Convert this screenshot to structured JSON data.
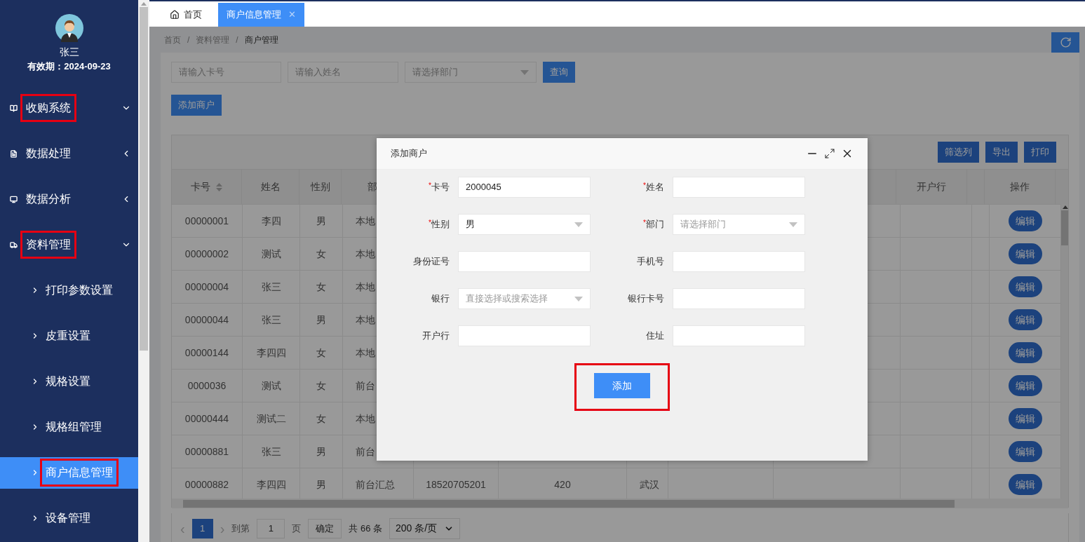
{
  "sidebar": {
    "user": {
      "name": "张三",
      "validity": "有效期：2024-09-23"
    },
    "items": [
      {
        "label": "收购系统",
        "expanded": true,
        "highlighted": true
      },
      {
        "label": "数据处理",
        "expanded": false,
        "highlighted": false
      },
      {
        "label": "数据分析",
        "expanded": false,
        "highlighted": false
      },
      {
        "label": "资料管理",
        "expanded": true,
        "highlighted": true,
        "children": [
          {
            "label": "打印参数设置",
            "selected": false,
            "highlighted": false
          },
          {
            "label": "皮重设置",
            "selected": false,
            "highlighted": false
          },
          {
            "label": "规格设置",
            "selected": false,
            "highlighted": false
          },
          {
            "label": "规格组管理",
            "selected": false,
            "highlighted": false
          },
          {
            "label": "商户信息管理",
            "selected": true,
            "highlighted": true
          },
          {
            "label": "设备管理",
            "selected": false,
            "highlighted": false
          }
        ]
      }
    ]
  },
  "tabs": [
    {
      "label": "首页",
      "selected": false,
      "closable": false
    },
    {
      "label": "商户信息管理",
      "selected": true,
      "closable": true,
      "close": "✕"
    }
  ],
  "breadcrumb": [
    "首页",
    "资料管理",
    "商户管理"
  ],
  "breadcrumb_separator": "/",
  "search": {
    "card_placeholder": "请输入卡号",
    "name_placeholder": "请输入姓名",
    "department_placeholder": "请选择部门",
    "button": "查询"
  },
  "add_button": "添加商户",
  "table": {
    "toolbar": [
      "筛选列",
      "导出",
      "打印"
    ],
    "columns_left": [
      "卡号",
      "姓名",
      "性别",
      "部"
    ],
    "columns_right": [
      "开户行",
      "操作"
    ],
    "rows": [
      {
        "cells": [
          "00000001",
          "李四",
          "男",
          "本地"
        ],
        "action": "编辑"
      },
      {
        "cells": [
          "00000002",
          "测试",
          "女",
          "本地"
        ],
        "action": "编辑"
      },
      {
        "cells": [
          "00000004",
          "张三",
          "女",
          "本地"
        ],
        "action": "编辑"
      },
      {
        "cells": [
          "00000044",
          "张三",
          "男",
          "本地"
        ],
        "action": "编辑"
      },
      {
        "cells": [
          "00000144",
          "李四四",
          "女",
          "本地"
        ],
        "action": "编辑"
      },
      {
        "cells": [
          "0000036",
          "测试",
          "女",
          "前台"
        ],
        "action": "编辑"
      },
      {
        "cells": [
          "00000444",
          "测试二",
          "女",
          "本地"
        ],
        "action": "编辑"
      },
      {
        "cells": [
          "00000881",
          "张三",
          "男",
          "前台"
        ],
        "action": "编辑"
      },
      {
        "cells": [
          "00000882",
          "李四四",
          "男",
          "前台汇总",
          "18520705201",
          "420",
          "武汉"
        ],
        "action": "编辑"
      }
    ]
  },
  "pagination": {
    "prev": "‹",
    "pages": [
      {
        "label": "1",
        "selected": true
      }
    ],
    "next": "›",
    "goto_label": "到第",
    "goto_value": "1",
    "page_unit": "页",
    "confirm": "确定",
    "total": "共 66 条",
    "page_size": "200 条/页"
  },
  "dialog": {
    "title": "添加商户",
    "fields": [
      {
        "label": "卡号",
        "required": true,
        "kind": "input",
        "value": "2000045"
      },
      {
        "label": "姓名",
        "required": true,
        "kind": "input"
      },
      {
        "label": "性别",
        "required": true,
        "kind": "select",
        "value": "男"
      },
      {
        "label": "部门",
        "required": true,
        "kind": "select",
        "placeholder": "请选择部门"
      },
      {
        "label": "身份证号",
        "required": false,
        "kind": "input"
      },
      {
        "label": "手机号",
        "required": false,
        "kind": "input"
      },
      {
        "label": "银行",
        "required": false,
        "kind": "select",
        "placeholder": "直接选择或搜索选择"
      },
      {
        "label": "银行卡号",
        "required": false,
        "kind": "input"
      },
      {
        "label": "开户行",
        "required": false,
        "kind": "input"
      },
      {
        "label": "住址",
        "required": false,
        "kind": "input"
      }
    ],
    "required_mark": "*",
    "submit": {
      "label": "添加",
      "highlighted": true
    }
  }
}
